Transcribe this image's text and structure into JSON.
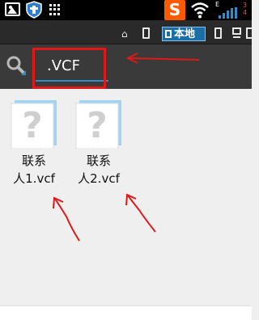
{
  "status_bar": {
    "icons": [
      "gallery-icon",
      "shield-icon",
      "grid-icon",
      "sogou-icon",
      "wifi-icon",
      "signal-icon",
      "battery-icon"
    ],
    "sogou_letter": "S",
    "network_type": "E",
    "battery_text": "3\n4"
  },
  "tab_bar": {
    "icons": [
      "home-icon",
      "phone-icon",
      "phone-icon",
      "computer-icon"
    ],
    "active_tab_label": "本地"
  },
  "search": {
    "value": ".VCF",
    "icon": "search-icon"
  },
  "files": [
    {
      "name": "联系\n人1.vcf",
      "icon": "unknown-file-icon"
    },
    {
      "name": "联系\n人2.vcf",
      "icon": "unknown-file-icon"
    }
  ],
  "colors": {
    "annotation_red": "#e01818",
    "accent_blue": "#2f8dc8",
    "sogou_orange": "#ff5a00"
  }
}
